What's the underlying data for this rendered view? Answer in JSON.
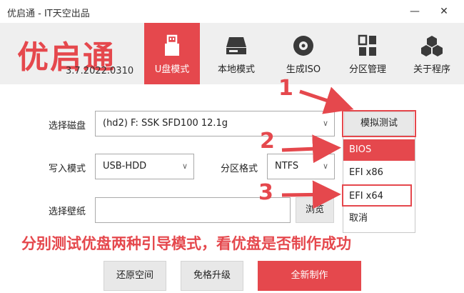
{
  "window": {
    "title": "优启通 - IT天空出品",
    "minimize_glyph": "—",
    "close_glyph": "✕"
  },
  "app": {
    "logo_text": "优启通",
    "version": "3.7.2022.0310"
  },
  "nav": {
    "items": [
      {
        "label": "U盘模式",
        "icon": "usb-drive-icon",
        "active": true
      },
      {
        "label": "本地模式",
        "icon": "hard-drive-icon",
        "active": false
      },
      {
        "label": "生成ISO",
        "icon": "disc-icon",
        "active": false
      },
      {
        "label": "分区管理",
        "icon": "partition-grid-icon",
        "active": false
      },
      {
        "label": "关于程序",
        "icon": "cubes-icon",
        "active": false
      }
    ]
  },
  "form": {
    "disk_label": "选择磁盘",
    "disk_value": "(hd2) F: SSK SFD100 12.1g",
    "write_mode_label": "写入模式",
    "write_mode_value": "USB-HDD",
    "partition_format_label": "分区格式",
    "partition_format_value": "NTFS",
    "wallpaper_label": "选择壁纸",
    "wallpaper_value": "",
    "browse_label": "浏览",
    "simulate_label": "模拟测试"
  },
  "simulate_menu": {
    "items": [
      "BIOS",
      "EFI x86",
      "EFI x64",
      "取消"
    ],
    "highlighted": "BIOS"
  },
  "annotations": {
    "step1": "1",
    "step2": "2",
    "step3": "3",
    "caption": "分别测试优盘两种引导模式，看优盘是否制作成功",
    "color": "#e5484d"
  },
  "footer": {
    "restore_label": "还原空间",
    "upgrade_label": "免格升级",
    "create_label": "全新制作"
  },
  "colors": {
    "accent": "#e5484d",
    "header_bg": "#efefef"
  }
}
